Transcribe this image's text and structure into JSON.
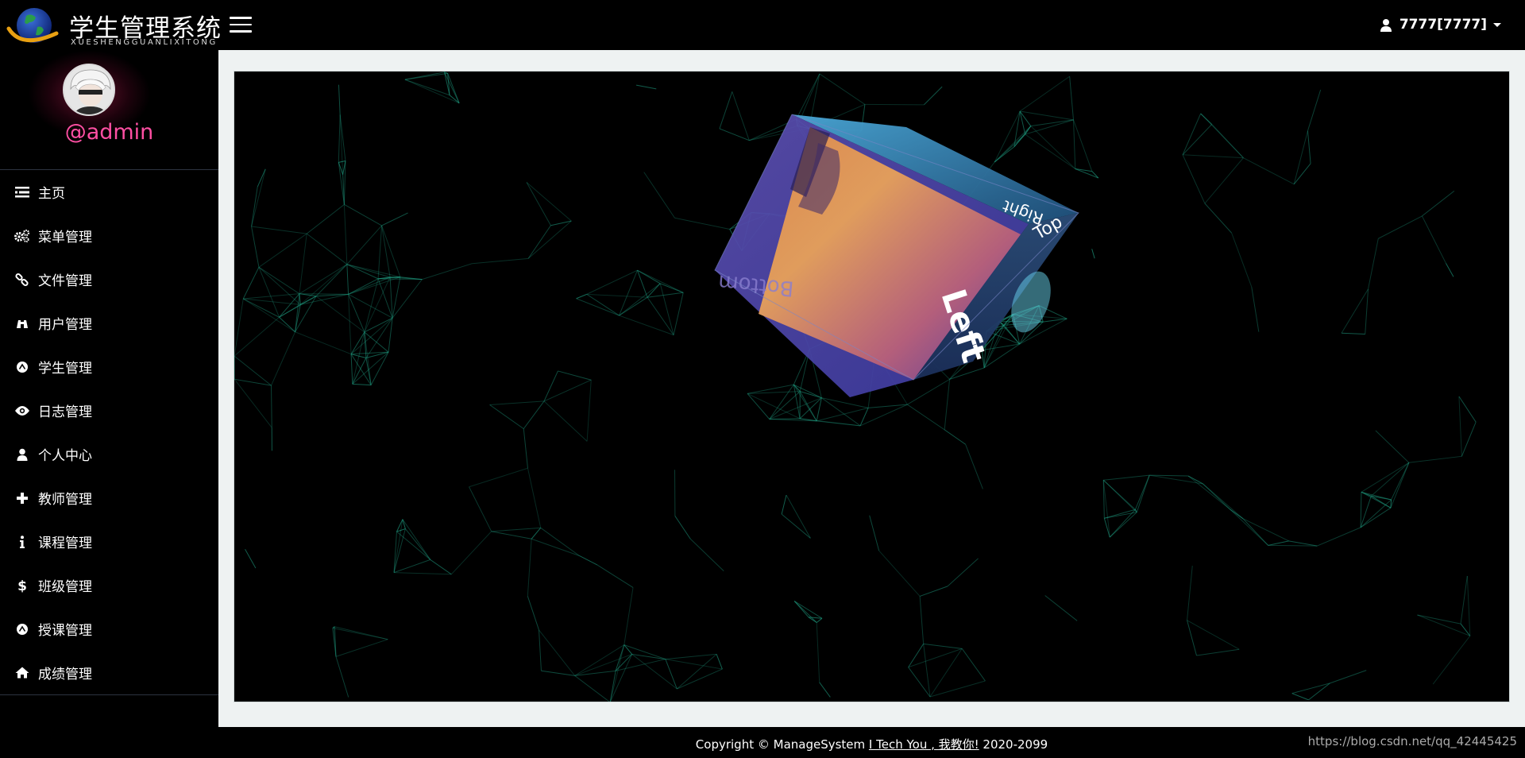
{
  "app": {
    "title": "学生管理系统",
    "subtitle": "XUESHENGGUANLIXITONG"
  },
  "header": {
    "user_label": "7777[7777]",
    "user_icon": "user-icon",
    "menu_icon": "hamburger-icon"
  },
  "profile": {
    "username": "@admin"
  },
  "sidebar": {
    "items": [
      {
        "label": "主页",
        "icon": "list-icon"
      },
      {
        "label": "菜单管理",
        "icon": "gears-icon"
      },
      {
        "label": "文件管理",
        "icon": "link-icon"
      },
      {
        "label": "用户管理",
        "icon": "binoculars-icon"
      },
      {
        "label": "学生管理",
        "icon": "circle-up-icon"
      },
      {
        "label": "日志管理",
        "icon": "eye-icon"
      },
      {
        "label": "个人中心",
        "icon": "user-icon"
      },
      {
        "label": "教师管理",
        "icon": "plus-icon"
      },
      {
        "label": "课程管理",
        "icon": "info-icon"
      },
      {
        "label": "班级管理",
        "icon": "dollar-icon"
      },
      {
        "label": "授课管理",
        "icon": "circle-up-icon"
      },
      {
        "label": "成绩管理",
        "icon": "home-icon"
      }
    ]
  },
  "cube": {
    "faces": [
      "Left",
      "Top",
      "Right",
      "Bottom"
    ]
  },
  "footer": {
    "prefix": "Copyright © ManageSystem ",
    "link": "I Tech You , 我教你!",
    "suffix": " 2020-2099",
    "watermark": "https://blog.csdn.net/qq_42445425"
  },
  "colors": {
    "accent_pink": "#ff4fa3",
    "network_line": "#1f9e82",
    "content_bg": "#eef2f2"
  }
}
